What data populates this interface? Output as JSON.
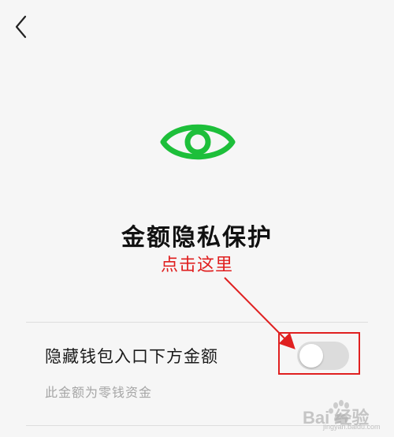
{
  "header": {
    "back_icon": "chevron-left-icon"
  },
  "hero": {
    "icon": "eye-icon",
    "icon_color": "#1dbf3a"
  },
  "page": {
    "title": "金额隐私保护"
  },
  "annotation": {
    "label": "点击这里",
    "color": "#e01e1e"
  },
  "setting": {
    "label": "隐藏钱包入口下方金额",
    "hint": "此金额为零钱资金",
    "toggle_on": false
  },
  "watermark": {
    "brand": "Bai 经验",
    "sub": "jingyan.baidu.com"
  }
}
